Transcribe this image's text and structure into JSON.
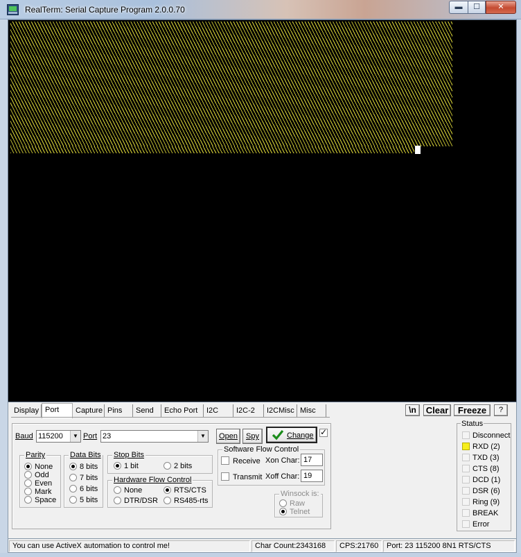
{
  "window": {
    "title": "RealTerm: Serial Capture Program 2.0.0.70",
    "min_glyph": "▬",
    "max_glyph": "☐",
    "close_glyph": "✕"
  },
  "tabs": [
    {
      "label": "Display",
      "active": false
    },
    {
      "label": "Port",
      "active": true
    },
    {
      "label": "Capture",
      "active": false
    },
    {
      "label": "Pins",
      "active": false
    },
    {
      "label": "Send",
      "active": false
    },
    {
      "label": "Echo Port",
      "active": false
    },
    {
      "label": "I2C",
      "active": false
    },
    {
      "label": "I2C-2",
      "active": false
    },
    {
      "label": "I2CMisc",
      "active": false
    },
    {
      "label": "Misc",
      "active": false
    }
  ],
  "toolbar": {
    "newline_label": "\\n",
    "clear_label": "Clear",
    "freeze_label": "Freeze",
    "help_label": "?"
  },
  "port": {
    "baud_label": "Baud",
    "baud_value": "115200",
    "port_label": "Port",
    "port_value": "23",
    "open_label": "Open",
    "spy_label": "Spy",
    "change_label": "Change",
    "change_check": true
  },
  "parity": {
    "title": "Parity",
    "options": [
      "None",
      "Odd",
      "Even",
      "Mark",
      "Space"
    ],
    "selected": "None"
  },
  "data_bits": {
    "title": "Data Bits",
    "options": [
      "8 bits",
      "7 bits",
      "6 bits",
      "5 bits"
    ],
    "selected": "8 bits"
  },
  "stop_bits": {
    "title": "Stop Bits",
    "options": [
      "1 bit",
      "2 bits"
    ],
    "selected": "1 bit"
  },
  "hw_flow": {
    "title": "Hardware Flow Control",
    "options": [
      "None",
      "RTS/CTS",
      "DTR/DSR",
      "RS485-rts"
    ],
    "selected": "RTS/CTS"
  },
  "sw_flow": {
    "title": "Software Flow Control",
    "receive_label": "Receive",
    "transmit_label": "Transmit",
    "xon_label": "Xon Char:",
    "xon_value": "17",
    "xoff_label": "Xoff Char:",
    "xoff_value": "19"
  },
  "winsock": {
    "title": "Winsock is:",
    "options": [
      "Raw",
      "Telnet"
    ],
    "selected": "Telnet"
  },
  "status": {
    "title": "Status",
    "items": [
      {
        "label": "Disconnect",
        "lit": false
      },
      {
        "label": "RXD (2)",
        "lit": true
      },
      {
        "label": "TXD (3)",
        "lit": false
      },
      {
        "label": "CTS (8)",
        "lit": false
      },
      {
        "label": "DCD (1)",
        "lit": false
      },
      {
        "label": "DSR (6)",
        "lit": false
      },
      {
        "label": "Ring (9)",
        "lit": false
      },
      {
        "label": "BREAK",
        "lit": false
      },
      {
        "label": "Error",
        "lit": false
      }
    ],
    "lit_color": "#f6ee1c"
  },
  "statusbar": {
    "message": "You can use ActiveX automation to control me!",
    "char_count": "Char Count:2343168",
    "cps": "CPS:21760",
    "port_info": "Port: 23 115200 8N1 RTS/CTS"
  },
  "terminal": {
    "background": "#000000",
    "text_color": "#e8e23a"
  }
}
